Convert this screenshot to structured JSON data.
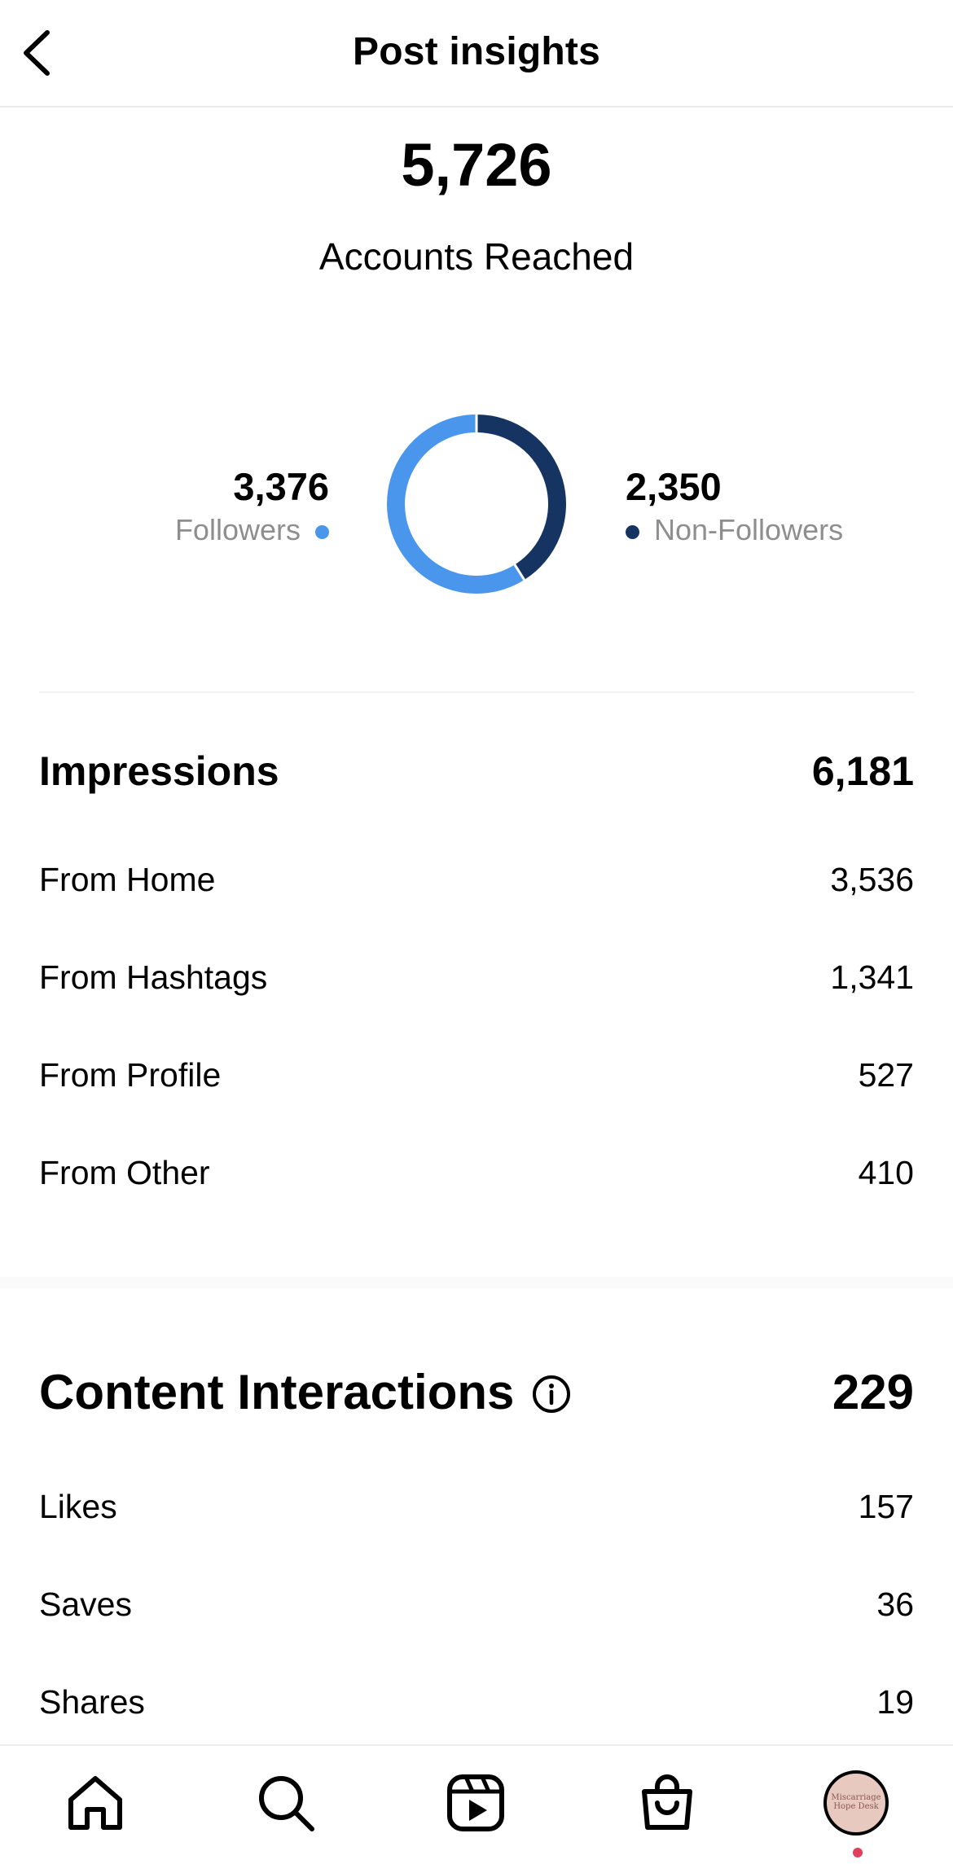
{
  "header": {
    "title": "Post insights"
  },
  "reach": {
    "value": "5,726",
    "label": "Accounts Reached",
    "followers": {
      "value": "3,376",
      "label": "Followers",
      "color": "#4a96ec"
    },
    "non_followers": {
      "value": "2,350",
      "label": "Non-Followers",
      "color": "#163462"
    }
  },
  "chart_data": {
    "type": "pie",
    "categories": [
      "Followers",
      "Non-Followers"
    ],
    "values": [
      3376,
      2350
    ],
    "colors": [
      "#4a96ec",
      "#163462"
    ],
    "donut": true
  },
  "impressions": {
    "title": "Impressions",
    "total": "6,181",
    "rows": [
      {
        "label": "From Home",
        "value": "3,536"
      },
      {
        "label": "From Hashtags",
        "value": "1,341"
      },
      {
        "label": "From Profile",
        "value": "527"
      },
      {
        "label": "From Other",
        "value": "410"
      }
    ]
  },
  "interactions": {
    "title": "Content Interactions",
    "total": "229",
    "rows": [
      {
        "label": "Likes",
        "value": "157"
      },
      {
        "label": "Saves",
        "value": "36"
      },
      {
        "label": "Shares",
        "value": "19"
      }
    ]
  },
  "tabbar": {
    "items": [
      "home-icon",
      "search-icon",
      "reels-icon",
      "shop-icon",
      "profile-avatar"
    ],
    "avatar_text": "Miscarriage Hope Desk",
    "notification_color": "#e0405b"
  }
}
